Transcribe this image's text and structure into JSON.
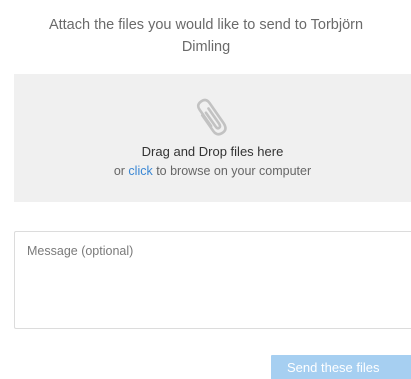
{
  "dialog": {
    "instruction_line1": "Attach the files you would like to send to Torbjörn",
    "instruction_line2": "Dimling"
  },
  "dropzone": {
    "icon": "paperclip-icon",
    "title": "Drag and Drop files here",
    "sub_prefix": "or ",
    "sub_link": "click",
    "sub_suffix": " to browse on your computer"
  },
  "message": {
    "placeholder": "Message (optional)",
    "value": ""
  },
  "actions": {
    "send_label": "Send these files"
  },
  "colors": {
    "dropzone_bg": "#f0f0f0",
    "link": "#3a87d4",
    "button_bg": "#a6cff1",
    "icon": "#c2c2c2"
  }
}
